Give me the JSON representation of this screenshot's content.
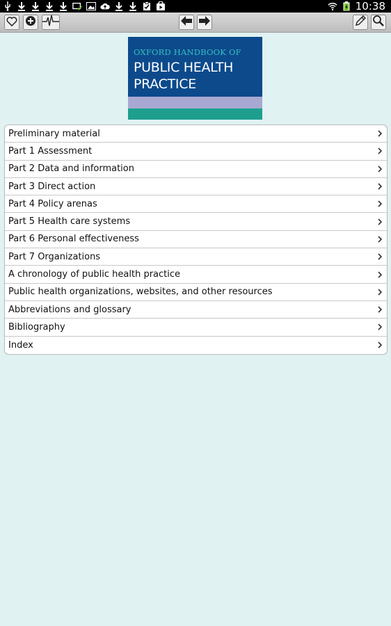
{
  "status_bar": {
    "time": "10:38",
    "left_icons": [
      "usb-icon",
      "download-icon",
      "download-icon",
      "download-icon",
      "download-icon",
      "screen-check-icon",
      "image-icon",
      "cloud-upload-icon",
      "download-icon",
      "download-icon",
      "clipboard-check-icon",
      "play-store-icon"
    ],
    "right_icons": [
      "wifi-icon",
      "battery-icon"
    ]
  },
  "toolbar": {
    "left_buttons": [
      "favorite-icon",
      "add-icon",
      "pulse-icon"
    ],
    "nav_buttons": [
      "back-arrow-icon",
      "forward-arrow-icon"
    ],
    "right_buttons": [
      "edit-icon",
      "search-icon"
    ]
  },
  "cover": {
    "line1": "OXFORD HANDBOOK OF",
    "line2": "PUBLIC HEALTH",
    "line3": "PRACTICE",
    "colors": {
      "blue": "#0c4a8c",
      "lilac": "#a8a8d2",
      "teal": "#1e9f8e",
      "subtitle": "#35c0c0"
    }
  },
  "menu": {
    "items": [
      {
        "label": "Preliminary material"
      },
      {
        "label": "Part 1 Assessment"
      },
      {
        "label": "Part 2 Data and information"
      },
      {
        "label": "Part 3 Direct action"
      },
      {
        "label": "Part 4 Policy arenas"
      },
      {
        "label": "Part 5 Health care systems"
      },
      {
        "label": "Part 6 Personal effectiveness"
      },
      {
        "label": "Part 7 Organizations"
      },
      {
        "label": "A chronology of public health practice"
      },
      {
        "label": "Public health organizations, websites, and other resources"
      },
      {
        "label": "Abbreviations and glossary"
      },
      {
        "label": "Bibliography"
      },
      {
        "label": "Index"
      }
    ]
  }
}
